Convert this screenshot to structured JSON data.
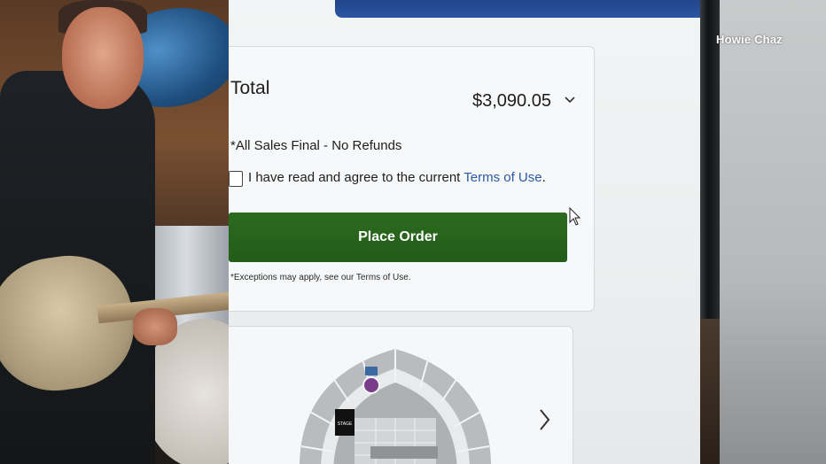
{
  "order": {
    "total_label": "Total",
    "total_amount": "$3,090.05",
    "final_notice": "*All Sales Final - No Refunds",
    "agree_text": "I have read and agree to the current ",
    "agree_link": "Terms of Use",
    "agree_suffix": ".",
    "agree_checked": false,
    "place_order_label": "Place Order",
    "exceptions_text": "*Exceptions may apply, see our Terms of Use."
  },
  "seat_map": {
    "stage_label": "STAGE"
  },
  "credit": "Howie Chaz",
  "colors": {
    "place_order_bg": "#2b6b1f",
    "link": "#2a5aa8",
    "selected_section": "#7a3d8c",
    "header_bar": "#23458a"
  },
  "icons": {
    "total_toggle": "chevron-down-icon",
    "map_next": "chevron-right-icon",
    "pointer": "mouse-cursor-icon"
  }
}
